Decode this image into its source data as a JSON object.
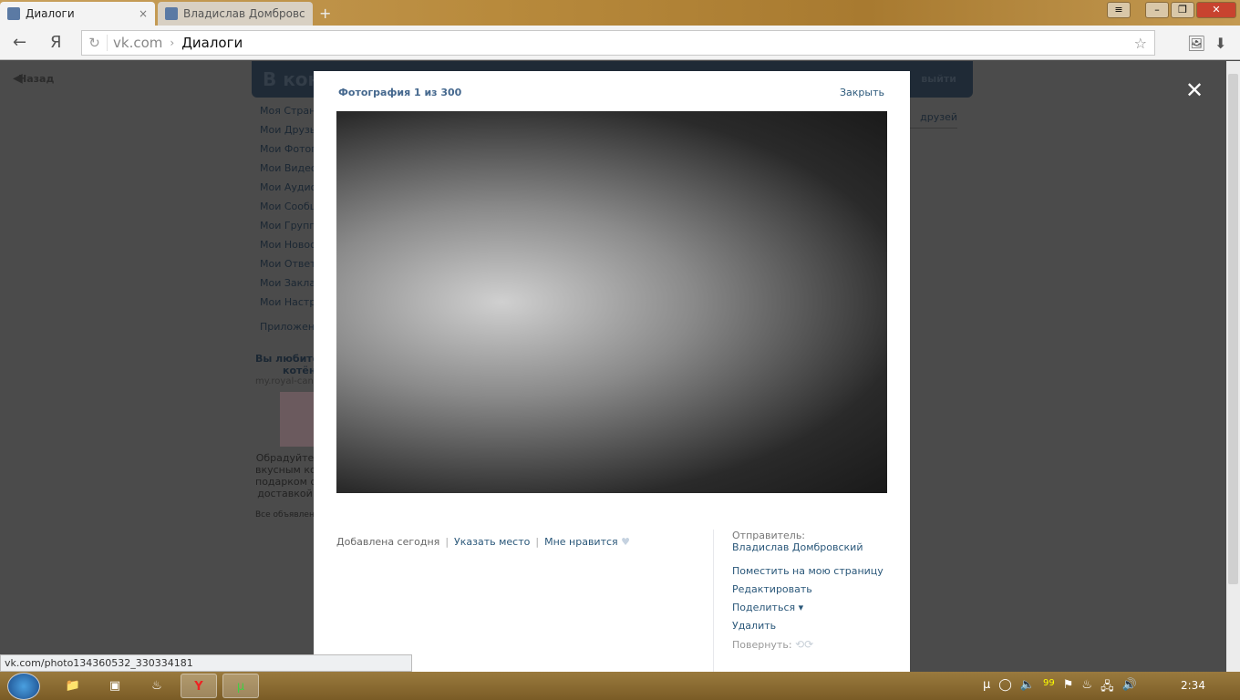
{
  "browser": {
    "tabs": [
      {
        "label": "Диалоги",
        "close": "×"
      },
      {
        "label": "Владислав Домбровс"
      }
    ],
    "new_tab": "+",
    "address_domain": "vk.com",
    "address_sep": "›",
    "address_title": "Диалоги",
    "back": "←",
    "logo": "Я",
    "reload": "↻",
    "star": "☆",
    "download": "⬇"
  },
  "page": {
    "back_label": "Назад",
    "vk_logo": "В конт",
    "logout": "выйти",
    "left_menu": [
      "Моя Страница",
      "Мои Друзья",
      "Мои Фотографии",
      "Мои Видеозаписи",
      "Мои Аудиозаписи",
      "Мои Сообщения",
      "Мои Группы",
      "Мои Новости",
      "Мои Ответы",
      "Мои Закладки",
      "Мои Настройки"
    ],
    "apps": "Приложения",
    "promo": {
      "title1": "Вы любите",
      "title2": "котёнка",
      "site": "my.royal-canin",
      "text": [
        "Обрадуйте",
        "вкусным кормом",
        "подарком с",
        "доставкой"
      ],
      "all_ads": "Все объявления"
    },
    "friends_tab": "друзей"
  },
  "viewer": {
    "title": "Фотография 1 из 300",
    "close": "Закрыть",
    "added": "Добавлена сегодня",
    "place": "Указать место",
    "like": "Мне нравится",
    "sender_label": "Отправитель:",
    "sender": "Владислав Домбровский",
    "actions": [
      "Поместить на мою страницу",
      "Редактировать",
      "Поделиться ▾",
      "Удалить"
    ],
    "rotate": "Повернуть:",
    "close_x": "✕"
  },
  "status_url": "vk.com/photo134360532_330334181",
  "taskbar": {
    "clock": "2:34",
    "tray": [
      "µ",
      "◯",
      "🔈",
      "99",
      "⚑",
      "♨",
      "🖧",
      "🔊"
    ]
  }
}
